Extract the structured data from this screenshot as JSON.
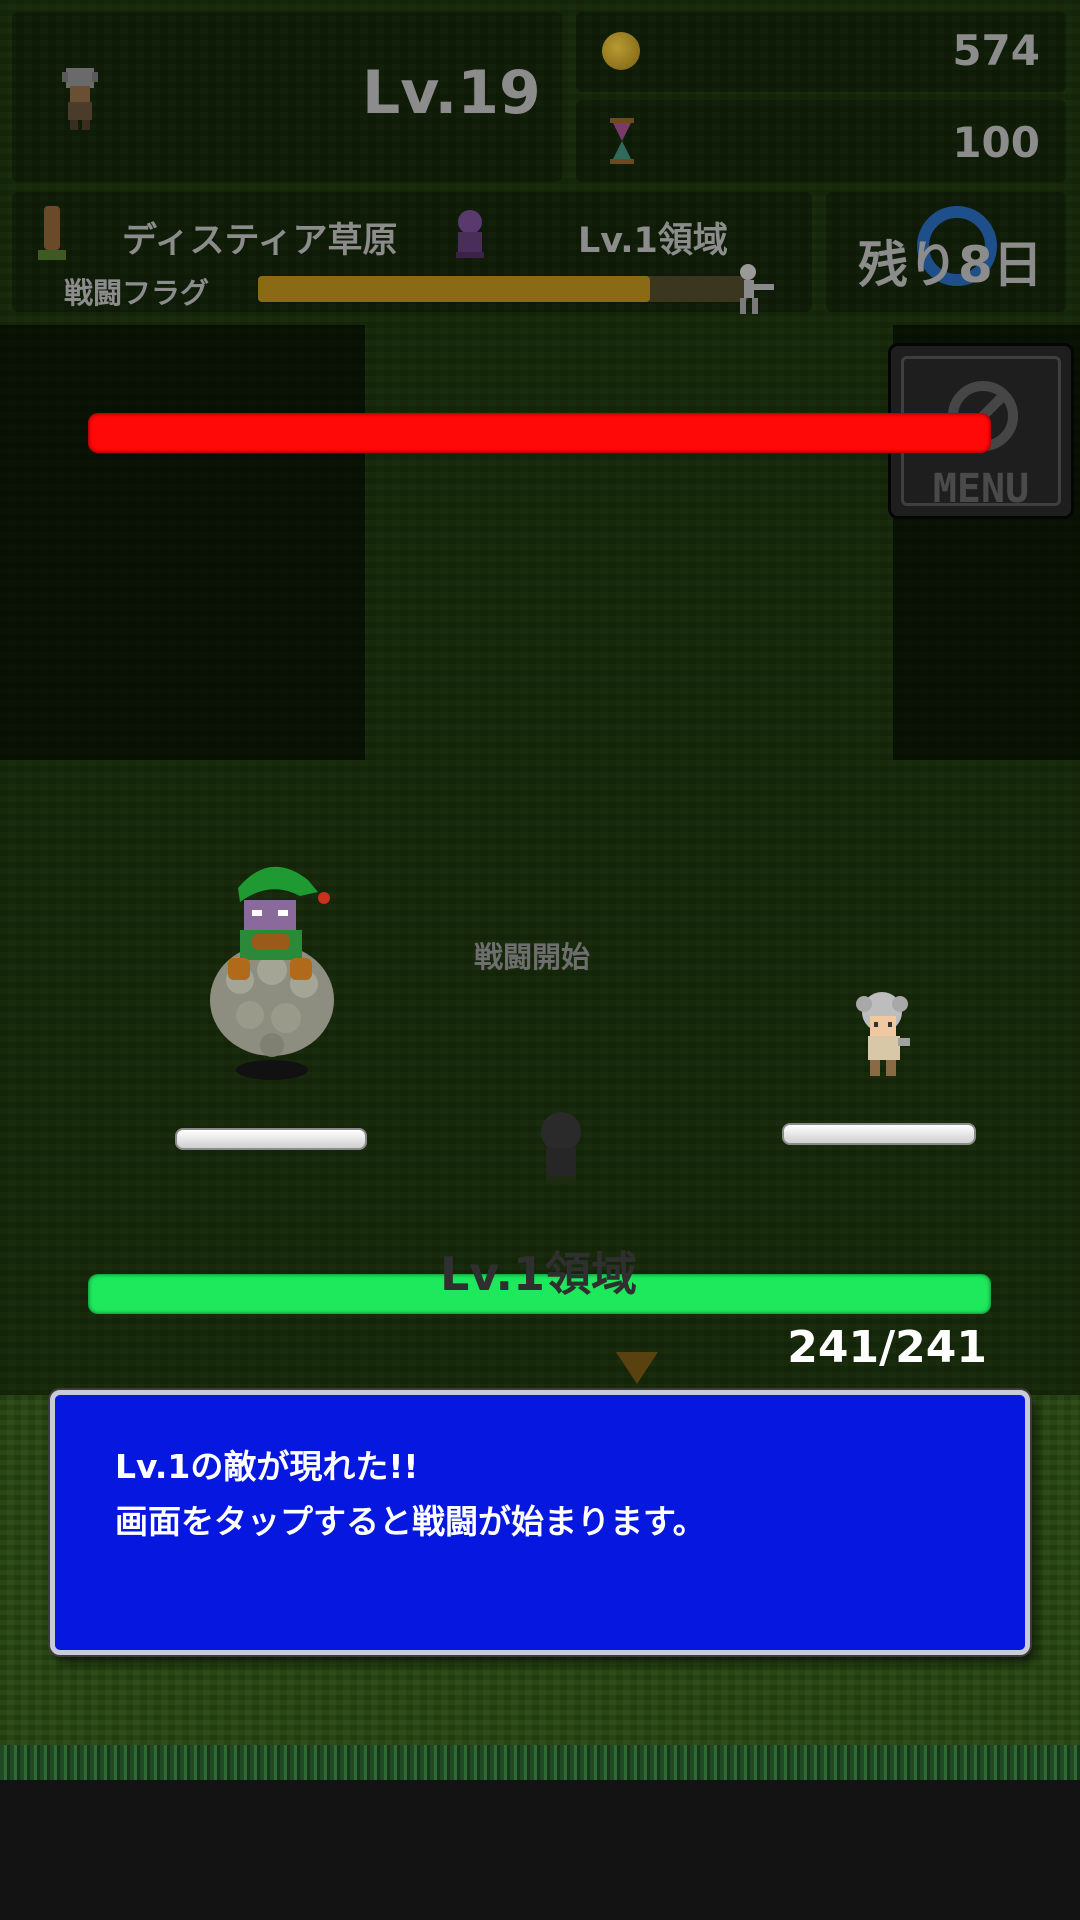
{
  "header": {
    "player_level": "Lv.19",
    "gold": "574",
    "time": "100",
    "area_name": "ディスティア草原",
    "area_level": "Lv.1領域",
    "flag_label": "戦闘フラグ",
    "flag_progress": 0.8,
    "days_left": "残り8日"
  },
  "menu": {
    "label": "MENU"
  },
  "battle": {
    "enemy_hp_fraction": 1.0,
    "status_text": "戦闘開始",
    "player_hp_text": "241/241",
    "player_hp_fraction": 1.0,
    "background_text": "Lv.1領域"
  },
  "dialog": {
    "line1": "Lv.1の敵が現れた!!",
    "line2": "画面をタップすると戦闘が始まります。"
  },
  "colors": {
    "enemy_hp": "#ff0808",
    "player_hp": "#1ee85c",
    "dialog_bg": "#0617e0"
  },
  "icons": [
    "player-portrait-icon",
    "gold-coin-icon",
    "hourglass-icon",
    "signpost-icon",
    "area-creature-icon",
    "running-figure-icon",
    "menu-icon"
  ]
}
